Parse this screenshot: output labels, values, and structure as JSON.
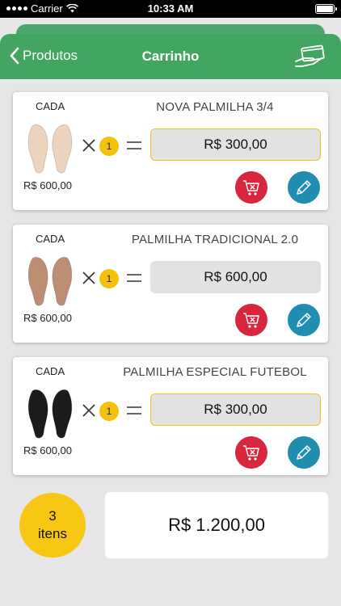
{
  "status_bar": {
    "carrier": "Carrier",
    "time": "10:33 AM",
    "icons": [
      "signal-dots-icon",
      "wifi-icon",
      "battery-icon"
    ]
  },
  "navbar": {
    "back_label": "Produtos",
    "title": "Carrinho",
    "icons": [
      "chevron-left-icon",
      "hand-card-payment-icon"
    ]
  },
  "colors": {
    "header_green": "#43a660",
    "accent_yellow": "#f4c20d",
    "delete_red": "#d7263d",
    "edit_teal": "#1f8db0"
  },
  "cart": {
    "items": [
      {
        "unit_label": "CADA",
        "name": "NOVA PALMILHA 3/4",
        "unit_price": "R$ 600,00",
        "quantity": "1",
        "total": "R$ 300,00",
        "insole_color": "#ecd3bd",
        "highlighted": true
      },
      {
        "unit_label": "CADA",
        "name": "PALMILHA TRADICIONAL 2.0",
        "unit_price": "R$ 600,00",
        "quantity": "1",
        "total": "R$ 600,00",
        "insole_color": "#bd8d74",
        "highlighted": false
      },
      {
        "unit_label": "CADA",
        "name": "PALMILHA ESPECIAL FUTEBOL",
        "unit_price": "R$ 600,00",
        "quantity": "1",
        "total": "R$ 300,00",
        "insole_color": "#1b1b1b",
        "highlighted": true
      }
    ]
  },
  "summary": {
    "count": "3",
    "count_label": "itens",
    "grand_total": "R$ 1.200,00"
  }
}
